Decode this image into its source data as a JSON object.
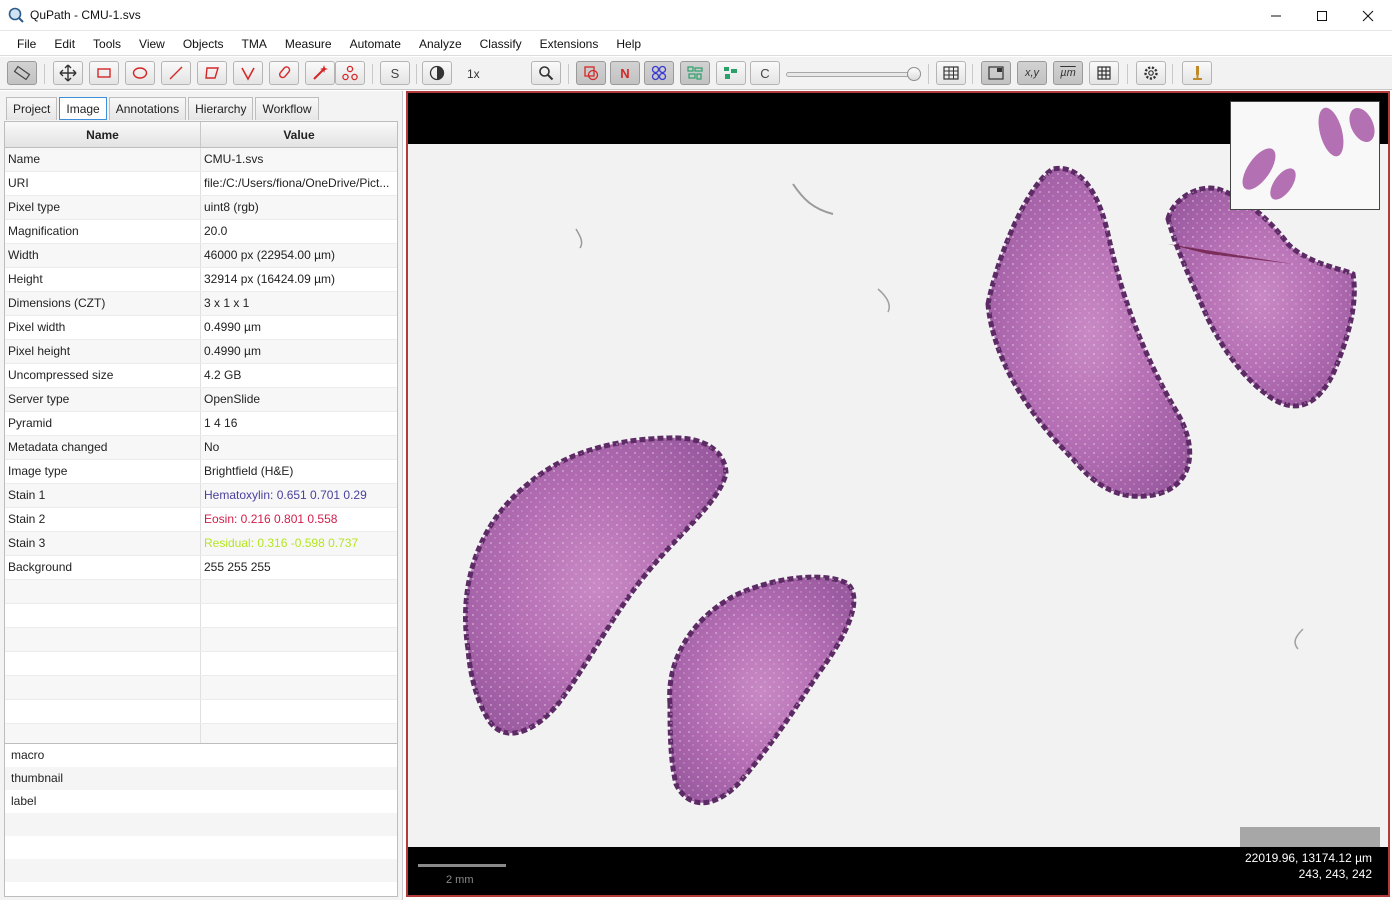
{
  "window": {
    "title": "QuPath - CMU-1.svs"
  },
  "menu": [
    "File",
    "Edit",
    "Tools",
    "View",
    "Objects",
    "TMA",
    "Measure",
    "Automate",
    "Analyze",
    "Classify",
    "Extensions",
    "Help"
  ],
  "toolbar": {
    "zoom_label": "1x",
    "S_label": "S",
    "N_label": "N",
    "C_label": "C",
    "xy_label": "x,y",
    "um_label": "µm"
  },
  "left_panel": {
    "tabs": [
      "Project",
      "Image",
      "Annotations",
      "Hierarchy",
      "Workflow"
    ],
    "selected_tab": "Image",
    "table": {
      "headers": [
        "Name",
        "Value"
      ],
      "rows": [
        [
          "Name",
          "CMU-1.svs"
        ],
        [
          "URI",
          "file:/C:/Users/fiona/OneDrive/Pict..."
        ],
        [
          "Pixel type",
          "uint8 (rgb)"
        ],
        [
          "Magnification",
          "20.0"
        ],
        [
          "Width",
          "46000 px (22954.00 µm)"
        ],
        [
          "Height",
          "32914 px (16424.09 µm)"
        ],
        [
          "Dimensions (CZT)",
          "3 x 1 x 1"
        ],
        [
          "Pixel width",
          "0.4990 µm"
        ],
        [
          "Pixel height",
          "0.4990 µm"
        ],
        [
          "Uncompressed size",
          "4.2 GB"
        ],
        [
          "Server type",
          "OpenSlide"
        ],
        [
          "Pyramid",
          "1 4 16"
        ],
        [
          "Metadata changed",
          "No"
        ],
        [
          "Image type",
          "Brightfield (H&E)"
        ],
        [
          "Stain 1",
          "Hematoxylin: 0.651 0.701 0.29"
        ],
        [
          "Stain 2",
          "Eosin: 0.216 0.801 0.558"
        ],
        [
          "Stain 3",
          "Residual: 0.316 -0.598 0.737"
        ],
        [
          "Background",
          "255 255 255"
        ]
      ],
      "stain_colors": {
        "stain1": "#4a3f9c",
        "stain2": "#d21e4a",
        "stain3": "#b4e61e"
      }
    },
    "associated_images": [
      "macro",
      "thumbnail",
      "label"
    ]
  },
  "viewer": {
    "scale_label": "2 mm",
    "cursor_position": "22019.96, 13174.12 µm",
    "cursor_rgb": "243, 243, 242",
    "border_color": "#b23a3a"
  }
}
